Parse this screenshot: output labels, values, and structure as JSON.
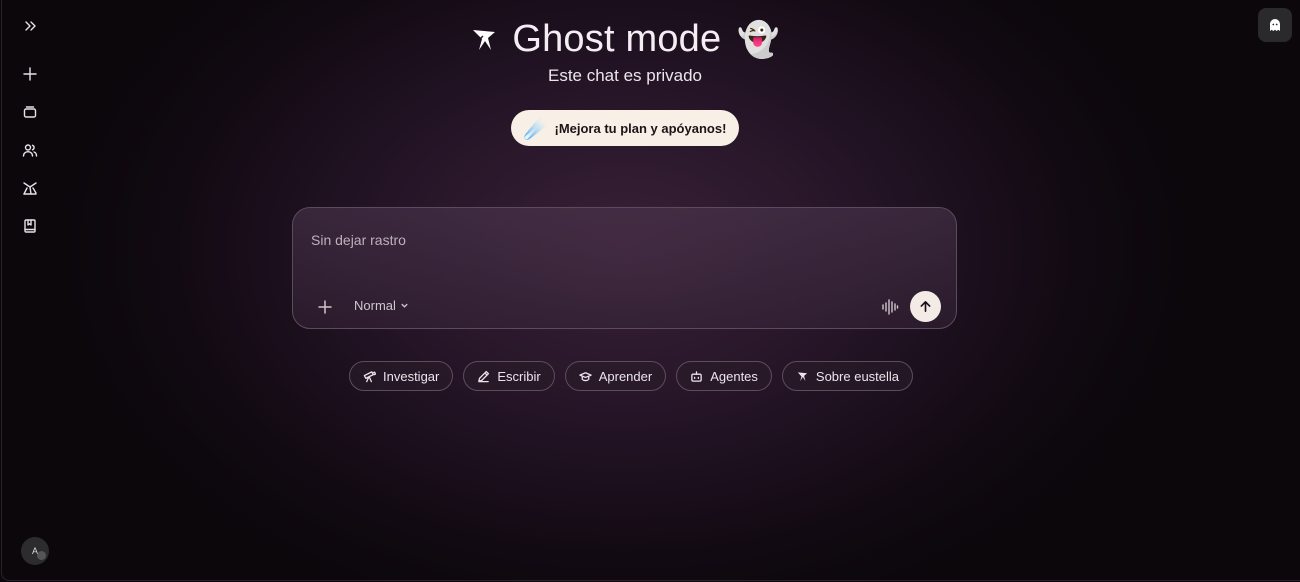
{
  "header": {
    "title": "Ghost mode",
    "subtitle": "Este chat es privado",
    "ghost_emoji": "👻",
    "logo_icon": "sparkle-plane-icon"
  },
  "upgrade": {
    "label": "¡Mejora tu plan y apóyanos!",
    "emoji": "☄️"
  },
  "sidebar": {
    "items": [
      {
        "icon": "expand-sidebar-icon"
      },
      {
        "icon": "new-chat-icon"
      },
      {
        "icon": "chats-icon"
      },
      {
        "icon": "users-icon"
      },
      {
        "icon": "explore-icon"
      },
      {
        "icon": "library-icon"
      }
    ],
    "avatar_text": "A"
  },
  "composer": {
    "placeholder": "Sin dejar rastro",
    "mode": "Normal"
  },
  "chips": [
    {
      "label": "Investigar",
      "icon": "telescope-icon"
    },
    {
      "label": "Escribir",
      "icon": "pencil-icon"
    },
    {
      "label": "Aprender",
      "icon": "graduation-cap-icon"
    },
    {
      "label": "Agentes",
      "icon": "robot-icon"
    },
    {
      "label": "Sobre eustella",
      "icon": "eustella-logo-icon"
    }
  ],
  "colors": {
    "accent_button": "#f8efe6",
    "background": "#241426"
  }
}
